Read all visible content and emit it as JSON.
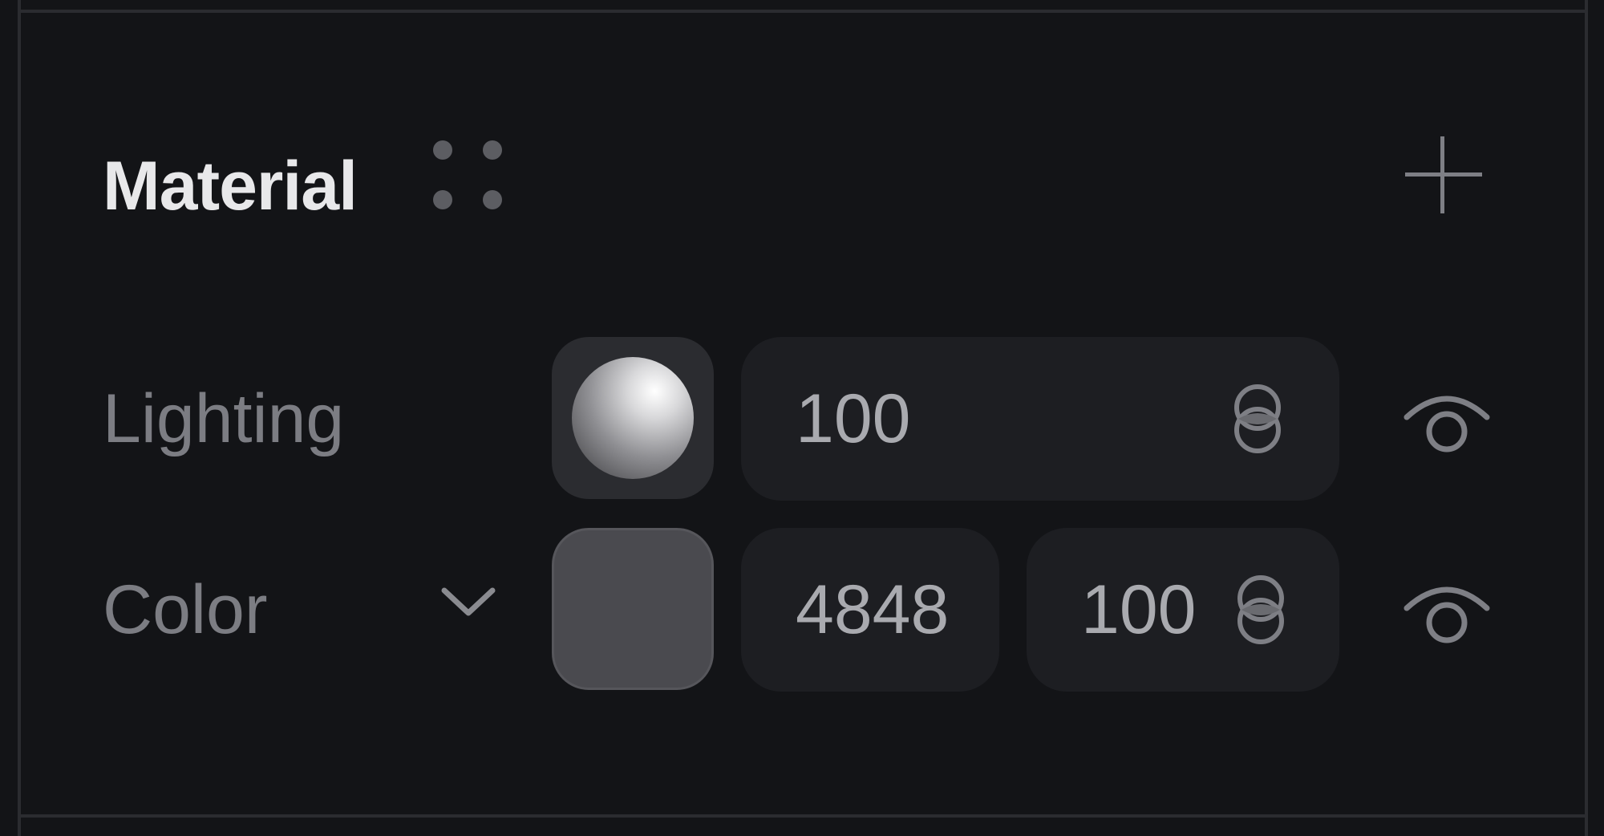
{
  "section": {
    "title": "Material"
  },
  "icons": {
    "drag": "drag-handle-icon",
    "add": "plus-icon",
    "link": "link-icon",
    "visibility": "eye-icon",
    "chevron": "chevron-down-icon"
  },
  "lighting": {
    "label": "Lighting",
    "value": "100"
  },
  "color": {
    "label": "Color",
    "hex": "4848",
    "opacity": "100",
    "swatch": "#4a4a4f"
  },
  "colors": {
    "background": "#131417",
    "field": "#1d1e22",
    "title": "#e8e8ea",
    "label": "#7c7d83",
    "value": "#a9aaaf"
  }
}
